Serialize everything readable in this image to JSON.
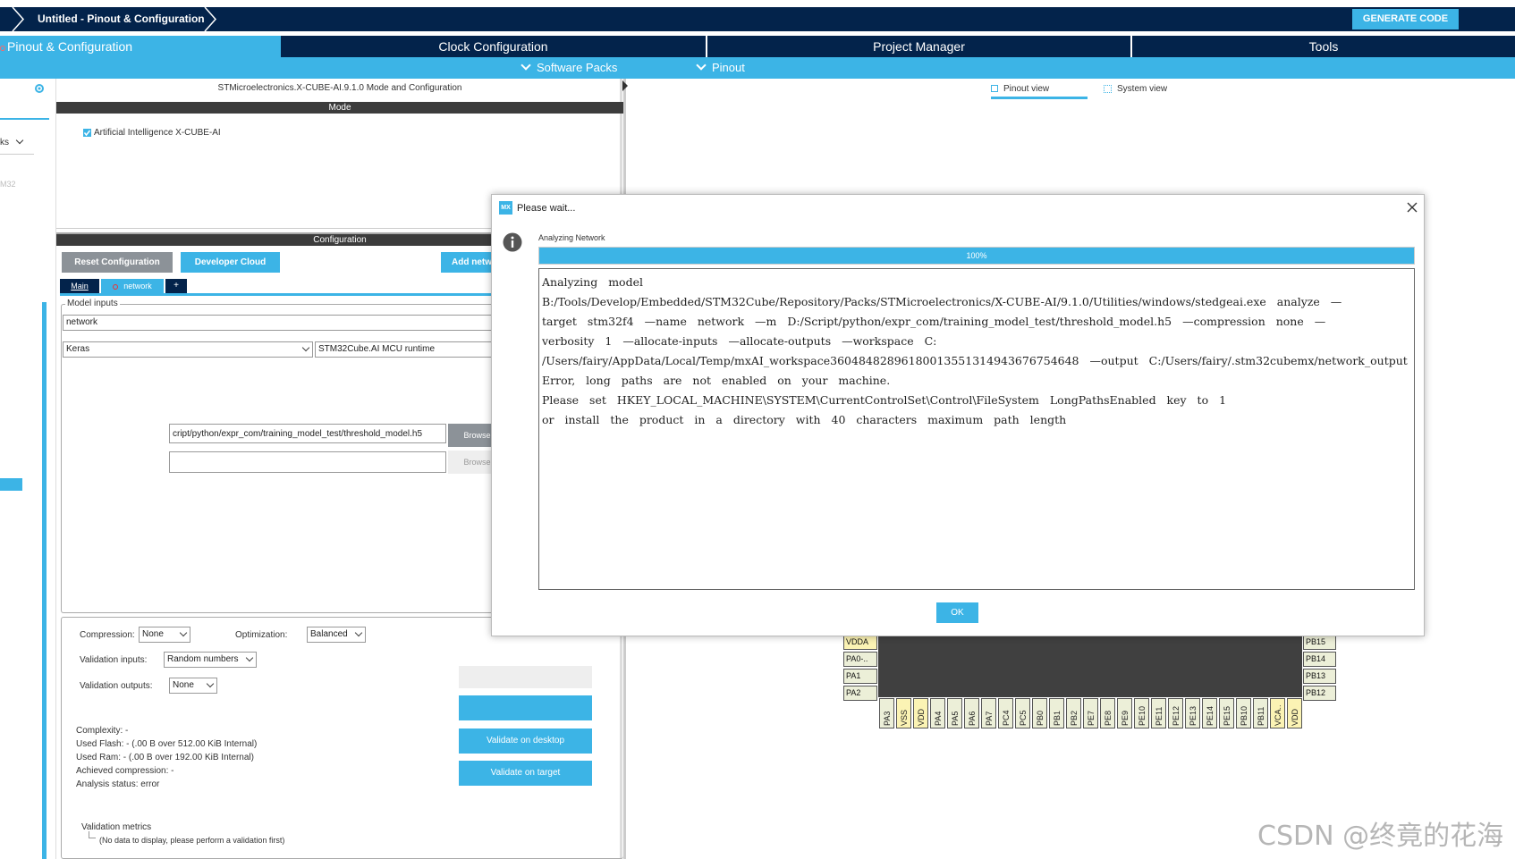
{
  "header": {
    "breadcrumb": "Untitled - Pinout & Configuration",
    "generate_label": "GENERATE CODE"
  },
  "tabs": [
    {
      "label": "Pinout & Configuration"
    },
    {
      "label": "Clock Configuration"
    },
    {
      "label": "Project Manager"
    },
    {
      "label": "Tools"
    }
  ],
  "subtabs": {
    "software_packs": "Software Packs",
    "pinout": "Pinout"
  },
  "sidebar": {
    "item_fragment": "ks",
    "stm_fragment": "M32"
  },
  "middle": {
    "title": "STMicroelectronics.X-CUBE-AI.9.1.0 Mode and Configuration",
    "mode_header": "Mode",
    "mode_checkbox_label": "Artificial Intelligence X-CUBE-AI",
    "config_header": "Configuration",
    "reset_button": "Reset Configuration",
    "developer_cloud_button": "Developer Cloud",
    "add_network_button": "Add netw",
    "tab_main": "Main",
    "tab_network": "network",
    "tab_add": "+",
    "model_inputs_label": "Model inputs",
    "network_name_value": "network",
    "framework_value": "Keras",
    "runtime_value": "STM32Cube.AI MCU runtime",
    "model_path_value": "cript/python/expr_com/training_model_test/threshold_model.h5",
    "model_path2_value": "",
    "browse_label": "Browse..",
    "browse2_label": "Browse..",
    "compression_label": "Compression:",
    "compression_value": "None",
    "optimization_label": "Optimization:",
    "optimization_value": "Balanced",
    "validation_inputs_label": "Validation inputs:",
    "validation_inputs_value": "Random numbers",
    "validation_outputs_label": "Validation outputs:",
    "validation_outputs_value": "None",
    "complexity": "Complexity: -",
    "used_flash": "Used Flash: - (.00 B over 512.00 KiB Internal)",
    "used_ram": "Used Ram: - (.00 B over 192.00 KiB Internal)",
    "achieved_compression": "Achieved compression: -",
    "analysis_status": "Analysis status: error",
    "validate_desktop_button": "Validate on desktop",
    "validate_target_button": "Validate on target",
    "validation_metrics_label": "Validation metrics",
    "validation_metrics_empty": "(No data to display, please perform a validation first)"
  },
  "right": {
    "pinout_view": "Pinout view",
    "system_view": "System view"
  },
  "chip": {
    "left_pins": [
      "VDDA",
      "PA0-..",
      "PA1",
      "PA2"
    ],
    "right_pins": [
      "PB15",
      "PB14",
      "PB13",
      "PB12"
    ],
    "bottom_pins": [
      {
        "name": "PA3",
        "yellow": false
      },
      {
        "name": "VSS",
        "yellow": true
      },
      {
        "name": "VDD",
        "yellow": true
      },
      {
        "name": "PA4",
        "yellow": false
      },
      {
        "name": "PA5",
        "yellow": false
      },
      {
        "name": "PA6",
        "yellow": false
      },
      {
        "name": "PA7",
        "yellow": false
      },
      {
        "name": "PC4",
        "yellow": false
      },
      {
        "name": "PC5",
        "yellow": false
      },
      {
        "name": "PB0",
        "yellow": false
      },
      {
        "name": "PB1",
        "yellow": false
      },
      {
        "name": "PB2",
        "yellow": false
      },
      {
        "name": "PE7",
        "yellow": false
      },
      {
        "name": "PE8",
        "yellow": false
      },
      {
        "name": "PE9",
        "yellow": false
      },
      {
        "name": "PE10",
        "yellow": false
      },
      {
        "name": "PE11",
        "yellow": false
      },
      {
        "name": "PE12",
        "yellow": false
      },
      {
        "name": "PE13",
        "yellow": false
      },
      {
        "name": "PE14",
        "yellow": false
      },
      {
        "name": "PE15",
        "yellow": false
      },
      {
        "name": "PB10",
        "yellow": false
      },
      {
        "name": "PB11",
        "yellow": false
      },
      {
        "name": "VCA..",
        "yellow": true
      },
      {
        "name": "VDD",
        "yellow": true
      }
    ]
  },
  "dialog": {
    "title": "Please wait...",
    "app_badge": "MX",
    "status": "Analyzing Network",
    "progress_label": "100%",
    "progress_value": 1.0,
    "log_lines": [
      "Analyzing model",
      "B:/Tools/Develop/Embedded/STM32Cube/Repository/Packs/STMicroelectronics/X-CUBE-AI/9.1.0/Utilities/windows/stedgeai.exe analyze —",
      "target stm32f4 —name network —m D:/Script/python/expr_com/training_model_test/threshold_model.h5 —compression none —",
      "verbosity 1 —allocate-inputs —allocate-outputs —workspace C:",
      "/Users/fairy/AppData/Local/Temp/mxAI_workspace3604848289618001355131494367675464​8 —output C:/Users/fairy/.stm32cubemx/network_output",
      "Error, long paths are not enabled on your machine.",
      "Please set HKEY_LOCAL_MACHINE\\SYSTEM\\CurrentControlSet\\Control\\FileSystem LongPathsEnabled key to 1",
      "or install the product in a directory with 40 characters maximum path length"
    ],
    "ok_button": "OK"
  },
  "watermark": "CSDN @终竟的花海"
}
